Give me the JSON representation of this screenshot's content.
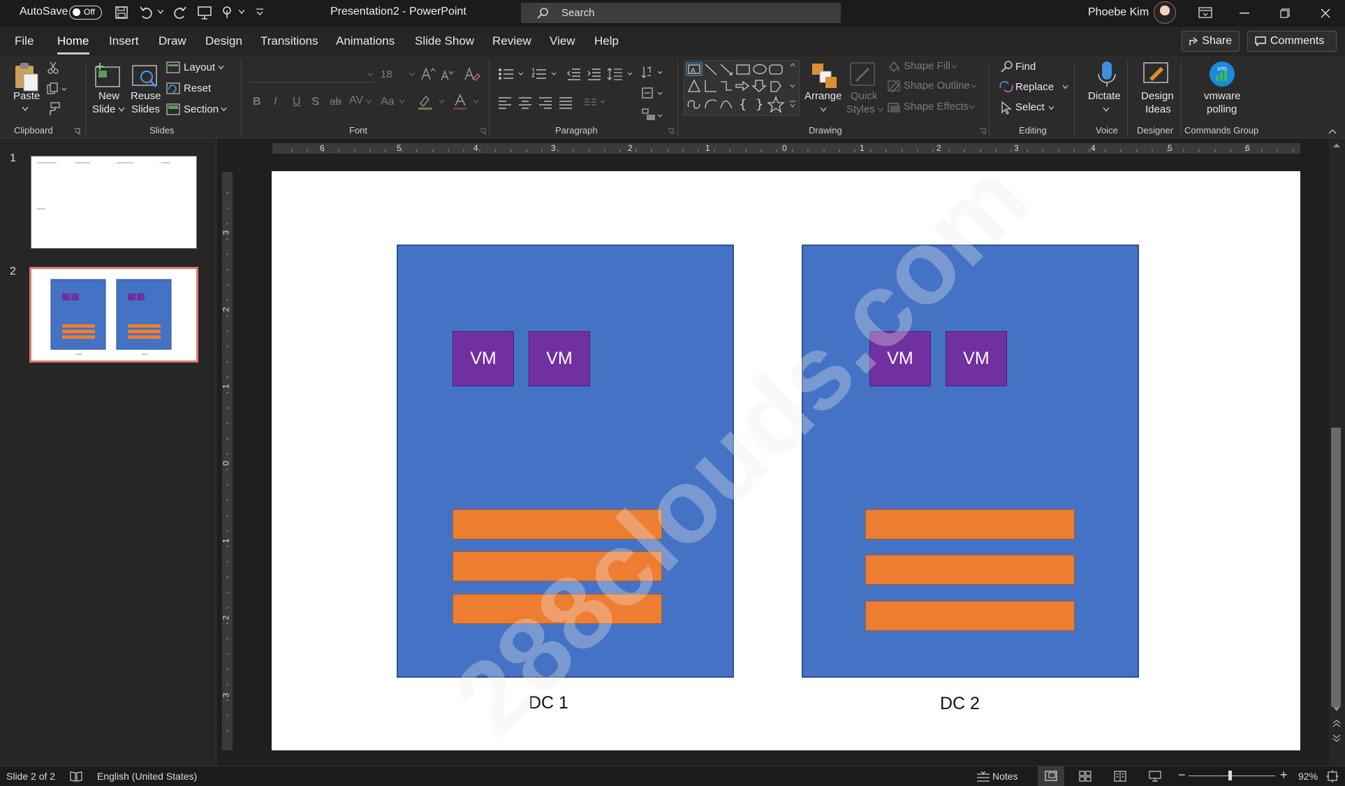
{
  "titlebar": {
    "autosave_label": "AutoSave",
    "autosave_state": "Off",
    "document_title": "Presentation2  -  PowerPoint",
    "search_placeholder": "Search",
    "user_name": "Phoebe Kim"
  },
  "menu": {
    "tabs": [
      "File",
      "Home",
      "Insert",
      "Draw",
      "Design",
      "Transitions",
      "Animations",
      "Slide Show",
      "Review",
      "View",
      "Help"
    ],
    "active_tab": "Home",
    "share_label": "Share",
    "comments_label": "Comments"
  },
  "ribbon": {
    "clipboard": {
      "paste": "Paste",
      "group": "Clipboard"
    },
    "slides": {
      "new_slide_1": "New",
      "new_slide_2": "Slide",
      "reuse_1": "Reuse",
      "reuse_2": "Slides",
      "layout": "Layout",
      "reset": "Reset",
      "section": "Section",
      "group": "Slides"
    },
    "font": {
      "size": "18",
      "bold": "B",
      "italic": "I",
      "underline": "U",
      "shadow": "S",
      "strike": "ab",
      "spacing": "AV",
      "case": "Aa",
      "group": "Font"
    },
    "paragraph": {
      "group": "Paragraph"
    },
    "drawing": {
      "arrange": "Arrange",
      "quick_1": "Quick",
      "quick_2": "Styles",
      "fill": "Shape Fill",
      "outline": "Shape Outline",
      "effects": "Shape Effects",
      "group": "Drawing"
    },
    "editing": {
      "find": "Find",
      "replace": "Replace",
      "select": "Select",
      "group": "Editing"
    },
    "voice": {
      "dictate": "Dictate",
      "group": "Voice"
    },
    "designer": {
      "ideas_1": "Design",
      "ideas_2": "Ideas",
      "group": "Designer"
    },
    "commands": {
      "vm_1": "vmware",
      "vm_2": "polling",
      "group": "Commands Group"
    }
  },
  "thumbnails": [
    {
      "number": "1"
    },
    {
      "number": "2"
    }
  ],
  "rulers": {
    "horizontal": [
      "6",
      "5",
      "4",
      "3",
      "2",
      "1",
      "0",
      "1",
      "2",
      "3",
      "4",
      "5",
      "6"
    ],
    "vertical": [
      "3",
      "2",
      "1",
      "0",
      "1",
      "2",
      "3"
    ]
  },
  "slide": {
    "watermark": "288clouds.com",
    "dc1": {
      "label": "DC 1",
      "vm_a": "VM",
      "vm_b": "VM"
    },
    "dc2": {
      "label": "DC 2",
      "vm_a": "VM",
      "vm_b": "VM"
    }
  },
  "status": {
    "slide_info": "Slide 2 of 2",
    "language": "English (United States)",
    "notes": "Notes",
    "zoom": "92%"
  },
  "colors": {
    "datacenter_fill": "#4472C4",
    "vm_fill": "#7030A0",
    "bar_fill": "#ED7D31",
    "selected_thumb_border": "#E0766E"
  }
}
